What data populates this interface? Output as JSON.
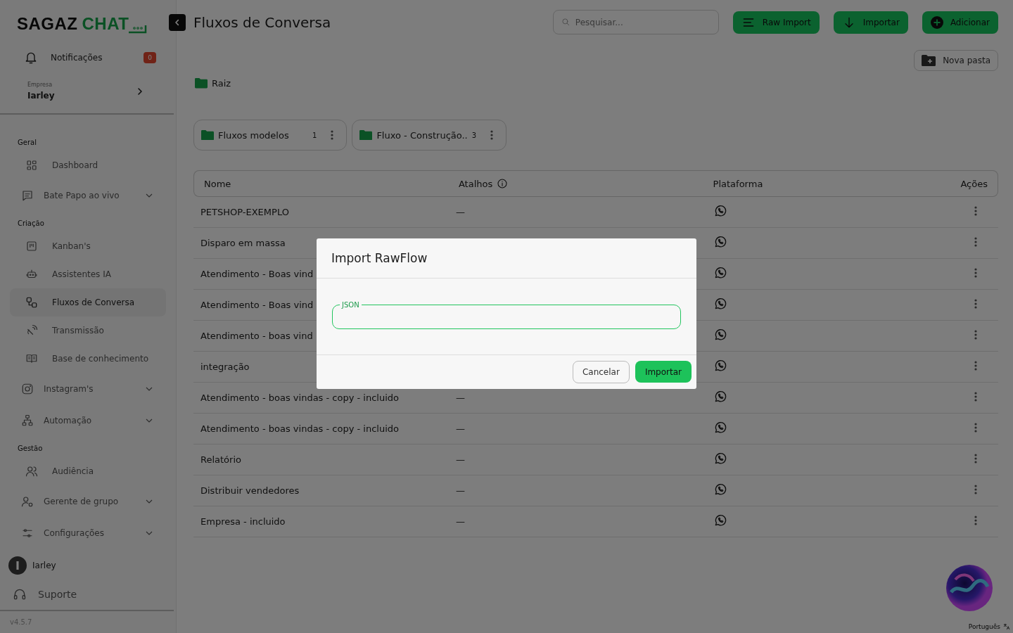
{
  "sidebar": {
    "logo": {
      "main": "SAGAZ",
      "accent": "CHAT"
    },
    "notifications": {
      "label": "Notificações",
      "badge": "0"
    },
    "company": {
      "caption": "Empresa",
      "name": "Iarley"
    },
    "sections": [
      {
        "title": "Geral",
        "items": [
          {
            "label": "Dashboard",
            "expandable": false,
            "selected": false
          },
          {
            "label": "Bate Papo ao vivo",
            "expandable": true,
            "selected": false
          }
        ]
      },
      {
        "title": "Criação",
        "items": [
          {
            "label": "Kanban's",
            "expandable": false,
            "selected": false
          },
          {
            "label": "Assistentes IA",
            "expandable": false,
            "selected": false
          },
          {
            "label": "Fluxos de Conversa",
            "expandable": false,
            "selected": true
          },
          {
            "label": "Transmissão",
            "expandable": false,
            "selected": false
          },
          {
            "label": "Base de conhecimento",
            "expandable": false,
            "selected": false
          },
          {
            "label": "Instagram's",
            "expandable": true,
            "selected": false
          },
          {
            "label": "Automação",
            "expandable": true,
            "selected": false
          }
        ]
      },
      {
        "title": "Gestão",
        "items": [
          {
            "label": "Audiência",
            "expandable": false,
            "selected": false
          },
          {
            "label": "Gerente de grupo",
            "expandable": true,
            "selected": false
          },
          {
            "label": "Configurações",
            "expandable": true,
            "selected": false
          }
        ]
      }
    ],
    "user": {
      "initial": "I",
      "name": "Iarley"
    },
    "support": "Suporte",
    "version": "v4.5.7"
  },
  "header": {
    "title": "Fluxos de Conversa",
    "search": {
      "placeholder": "Pesquisar..."
    },
    "buttons": [
      "Raw Import",
      "Importar",
      "Adicionar"
    ],
    "new_folder": "Nova pasta"
  },
  "breadcrumb": "Raiz",
  "folders": [
    {
      "name": "Fluxos modelos",
      "count": "1"
    },
    {
      "name": "Fluxo - Construção..",
      "count": "3"
    }
  ],
  "table": {
    "columns": [
      "Nome",
      "Atalhos",
      "Plataforma",
      "Ações"
    ],
    "rows": [
      {
        "name": "PETSHOP-EXEMPLO",
        "shortcut": "—"
      },
      {
        "name": "Disparo em massa"
      },
      {
        "name": "Atendimento - Boas vind"
      },
      {
        "name": "Atendimento - Boas vind"
      },
      {
        "name": "Atendimento - boas vind"
      },
      {
        "name": "integração"
      },
      {
        "name": "Atendimento - boas vindas - copy - incluido",
        "shortcut": "—"
      },
      {
        "name": "Atendimento - boas vindas - copy - incluido",
        "shortcut": "—"
      },
      {
        "name": "Relatório",
        "shortcut": "—"
      },
      {
        "name": "Distribuir vendedores",
        "shortcut": "—"
      },
      {
        "name": "Empresa - incluido",
        "shortcut": "—"
      }
    ]
  },
  "modal": {
    "title": "Import RawFlow",
    "field_label": "JSON",
    "buttons": [
      "Cancelar",
      "Importar"
    ]
  },
  "language": "Português"
}
